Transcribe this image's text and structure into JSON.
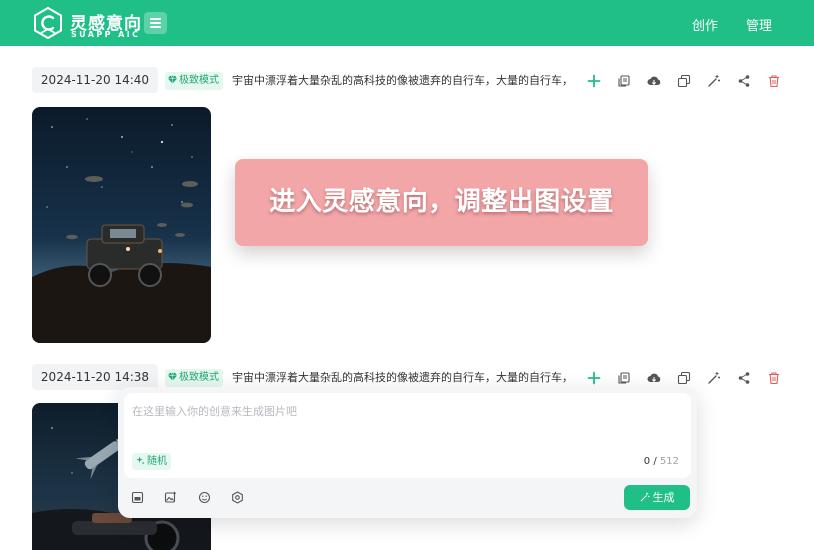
{
  "header": {
    "brand": "灵感意向",
    "brand_sub": "SUAPP AIC",
    "nav": [
      "创作",
      "管理"
    ]
  },
  "records": [
    {
      "date": "2024-11-20 14:40",
      "mode": "极致模式",
      "prompt": "宇宙中漂浮着大量杂乱的高科技的像被遗弃的自行车，大量的自行车，"
    },
    {
      "date": "2024-11-20 14:38",
      "mode": "极致模式",
      "prompt": "宇宙中漂浮着大量杂乱的高科技的像被遗弃的自行车，大量的自行车，"
    }
  ],
  "actions": [
    "add-icon",
    "copy-prompt-icon",
    "cloud-download-icon",
    "duplicate-icon",
    "magic-wand-icon",
    "share-icon",
    "delete-icon"
  ],
  "banner": {
    "text": "进入灵感意向，调整出图设置"
  },
  "composer": {
    "placeholder": "在这里输入你的创意来生成图片吧",
    "random_label": "随机",
    "count": "0",
    "separator": " / ",
    "max": "512",
    "generate_label": "生成",
    "tools": [
      "image-ratio-icon",
      "image-reference-icon",
      "emoji-style-icon",
      "settings-icon"
    ]
  },
  "colors": {
    "brand": "#1fbf87",
    "badge_bg": "#e6f7f0",
    "delete": "#e85a5a",
    "banner": "#f2a6a8"
  }
}
